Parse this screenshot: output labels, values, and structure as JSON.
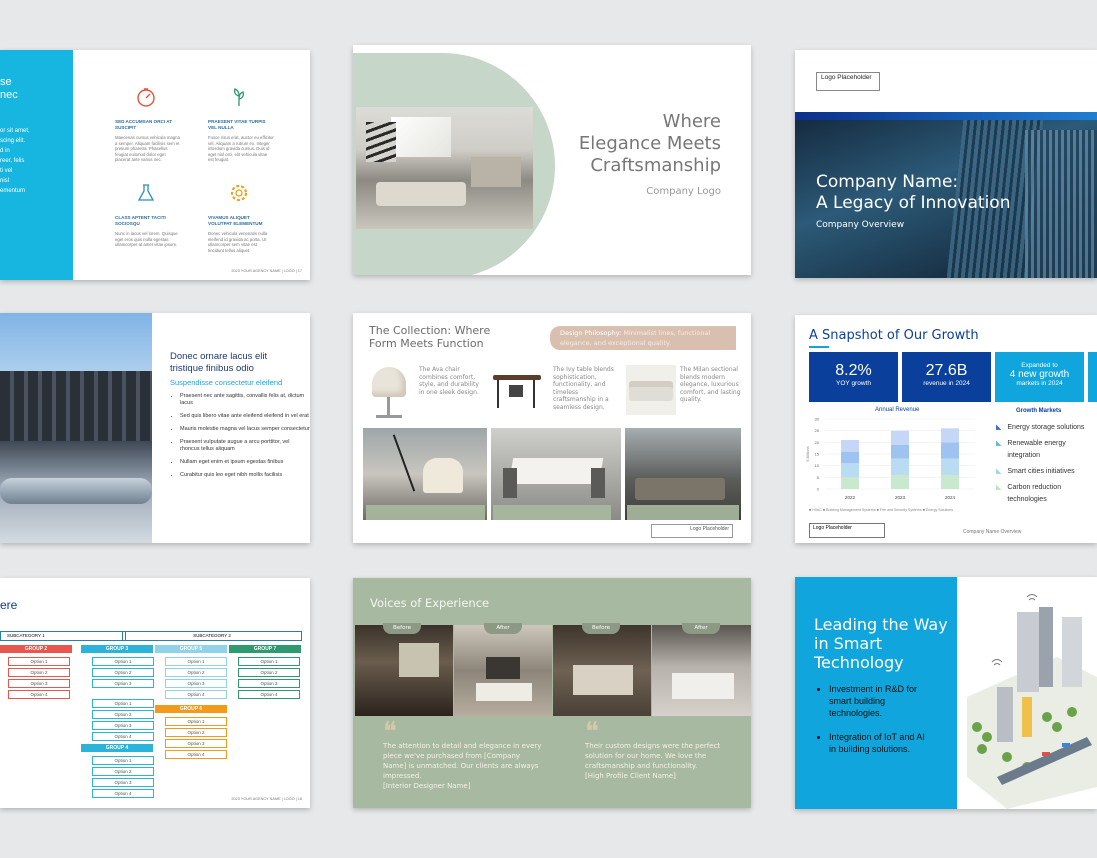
{
  "s1": {
    "title_frag": [
      "se",
      "nec"
    ],
    "body_frag": [
      "or sit amet,",
      "scing elit.",
      "d in",
      "reer, felis",
      "ti vel",
      "nisl",
      "ementum"
    ],
    "features": [
      {
        "icon": "timer-icon",
        "title": "SED ACCUMSAN ORCI AT SUSCIPIT",
        "text": "Maecenas cursus vehicula magna a semper. Aliquam facilisis sem et pretium pharetra. Phasellus feugiat euismod dolor eget placerat ante varius nec."
      },
      {
        "icon": "sprout-icon",
        "title": "PRAESENT VITAE TURPIS VEL NULLA",
        "text": "Fusce risus erat, auctor eu efficitur vel. Aliquam a rutrum ex. Integer interdum gravida cursus. Duis id eget nisl orci, elit vehicula vitae est feugiat."
      },
      {
        "icon": "flask-icon",
        "title": "CLASS APTENT TACITI SOCIOSQU",
        "text": "Nunc in lacus vel lorem. Quisque eget eros quis nulla egestas ullamcorper at amet vitae ipsum."
      },
      {
        "icon": "gear-icon",
        "title": "VIVAMUS ALIQUET VOLUTPAT ELEMENTUM",
        "text": "Donec vehicula venenatis nulla eleifend id gravida ac porta. Ut ullamcorper sem vitae est tincidunt tellus aliquet."
      }
    ],
    "footer": "2023 YOUR AGENCY NAME | LOGO | 17"
  },
  "s2": {
    "title_lines": [
      "Where",
      "Elegance Meets",
      "Craftsmanship"
    ],
    "logo_text": "Company Logo"
  },
  "s3": {
    "logo_text": "Logo Placeholder",
    "title_lines": [
      "Company Name:",
      "A Legacy of Innovation"
    ],
    "subtitle": "Company Overview"
  },
  "s4": {
    "title": "Donec ornare lacus elit tristique finibus odio",
    "subtitle": "Suspendisse consectetur eleifend",
    "bullets": [
      "Praesent nec ante sagittis, convallis felis at, dictum lacus",
      "Sed quis libero vitae ante eleifend eleifend in vel erat",
      "Mauris molestie magna vel lacus semper consectetur",
      "Praesent vulputate augue a arcu porttitor, vel rhoncus tellus aliquam",
      "Nullam eget enim et ipsum egestas finibus",
      "Curabitur quis leo eget nibh mollis facilisis"
    ]
  },
  "s5": {
    "title_lines": [
      "The Collection: Where",
      "Form Meets Function"
    ],
    "philosophy_label": "Design Philosophy:",
    "philosophy_text": "Minimalist lines, functional elegance, and exceptional quality.",
    "items": [
      "The Ava chair combines comfort, style, and durability in one sleek design.",
      "The Ivy table blends sophistication, functionality, and timeless craftsmanship in a seamless design.",
      "The Milan sectional blends modern elegance, luxurious comfort, and lasting quality."
    ],
    "logo_text": "Logo Placeholder"
  },
  "s6": {
    "title": "A Snapshot of Our Growth",
    "stats": [
      {
        "value": "8.2%",
        "label": "YOY growth"
      },
      {
        "value": "27.6B",
        "label": "revenue in 2024"
      },
      {
        "top": "Expanded to",
        "value": "4 new growth",
        "label": "markets in 2024"
      }
    ],
    "chart_title": "Annual Revenue",
    "markets_title": "Growth Markets",
    "markets": [
      "Energy storage solutions",
      "Renewable energy integration",
      "Smart cities initiatives",
      "Carbon reduction technologies"
    ],
    "legend_note": "■ HVAC ■ Building Management Systems ■ Fire and Security Systems ■ Energy Solutions",
    "logo_text": "Logo Placeholder",
    "footer": "Company Name Overview",
    "colors": {
      "navy": "#0a3f9c",
      "cyan": "#10a5dc"
    }
  },
  "chart_data": {
    "type": "bar",
    "title": "Annual Revenue",
    "categories": [
      "2022",
      "2023",
      "2024"
    ],
    "series": [
      {
        "name": "HVAC",
        "values": [
          5,
          6,
          6
        ]
      },
      {
        "name": "Building Management Systems",
        "values": [
          6,
          7,
          7
        ]
      },
      {
        "name": "Fire and Security Systems",
        "values": [
          5,
          6,
          7
        ]
      },
      {
        "name": "Energy Solutions",
        "values": [
          5,
          6,
          6
        ]
      }
    ],
    "ylim": [
      0,
      30
    ],
    "yticks": [
      "0",
      "5",
      "10",
      "15",
      "20",
      "25",
      "30"
    ],
    "ylabel": "$ Billions",
    "legend_position": "bottom"
  },
  "s7": {
    "title_frag": "ere",
    "subcats": [
      "SUBCATEGORY 1",
      "SUBCATEGORY 2"
    ],
    "groups": {
      "g2": "GROUP 2",
      "g3": "GROUP 3",
      "g5": "GROUP 5",
      "g7": "GROUP 7",
      "g4": "GROUP 4",
      "g6": "GROUP 6"
    },
    "option": [
      "Option 1",
      "Option 2",
      "Option 3",
      "Option 4"
    ],
    "footer": "2023 YOUR AGENCY NAME | LOGO | 18"
  },
  "s8": {
    "title": "Voices of Experience",
    "tags": [
      "Before",
      "After",
      "Before",
      "After"
    ],
    "quote1": "The attention to detail and elegance in every piece we've purchased from [Company Name] is unmatched. Our clients are always impressed.",
    "quote1_author": "[Interior Designer Name]",
    "quote2": "Their custom designs were the perfect solution for our home. We love the craftsmanship and functionality.",
    "quote2_author": "[High Profile Client Name]"
  },
  "s9": {
    "title_lines": [
      "Leading the Way",
      "in Smart",
      "Technology"
    ],
    "bullets": [
      "Investment in R&D for smart building technologies.",
      "Integration of IoT and AI in building solutions."
    ]
  }
}
